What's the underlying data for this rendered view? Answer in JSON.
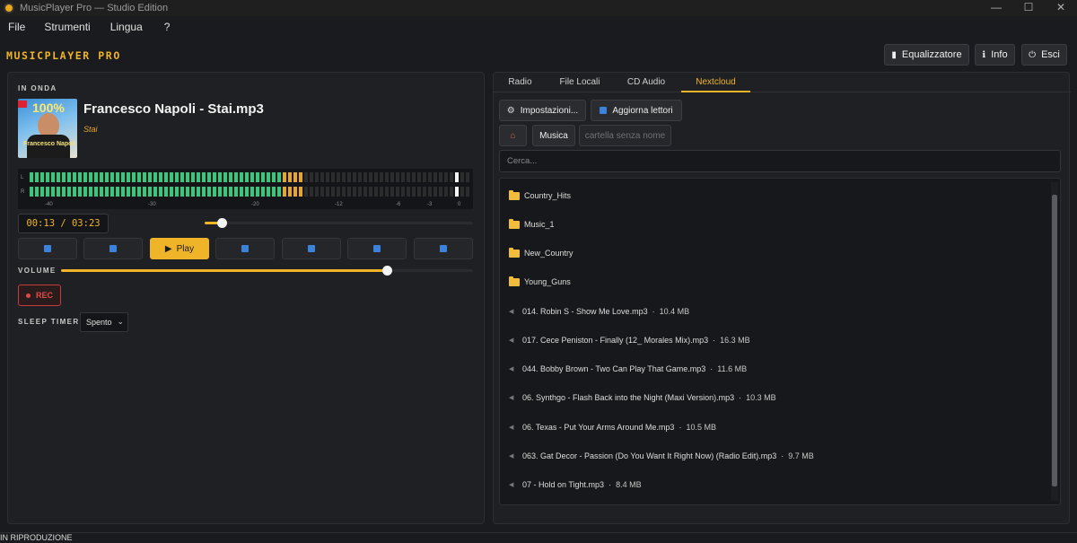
{
  "window": {
    "title": "MusicPlayer Pro — Studio Edition",
    "controls": [
      "—",
      "☐",
      "✕"
    ]
  },
  "menu": [
    "File",
    "Strumenti",
    "Lingua",
    "?"
  ],
  "brand": "MUSICPLAYER PRO",
  "toolbar": {
    "equalizer": "Equalizzatore",
    "info": "Info",
    "exit": "Esci"
  },
  "player": {
    "on_air_label": "IN ONDA",
    "title": "Francesco Napoli - Stai.mp3",
    "subtitle": "Stai",
    "cover_text": "100%",
    "cover_artist": "Francesco Napoli",
    "meter": {
      "channels": [
        "L",
        "R"
      ],
      "scale": [
        "-40",
        "-30",
        "-20",
        "-12",
        "-6",
        "-3",
        "0"
      ]
    },
    "time_display": "00:13 / 03:23",
    "seek_fraction": 0.065,
    "play_label": "Play",
    "controls": [
      "shuffle",
      "previous",
      "play",
      "pause",
      "stop",
      "next",
      "repeat"
    ],
    "volume_label": "VOLUME",
    "volume_fraction": 0.79,
    "rec_label": "REC",
    "sleep_label": "SLEEP TIMER",
    "sleep_value": "Spento"
  },
  "browser": {
    "tabs": [
      "Radio",
      "File Locali",
      "CD Audio",
      "Nextcloud"
    ],
    "active_tab": "Nextcloud",
    "settings_label": "Impostazioni...",
    "refresh_label": "Aggiorna lettori",
    "path": [
      "Musica",
      "cartella senza nome"
    ],
    "search_placeholder": "Cerca...",
    "folders": [
      "Country_Hits",
      "Music_1",
      "New_Country",
      "Young_Guns"
    ],
    "files": [
      {
        "name": "014. Robin S - Show Me Love.mp3",
        "size": "10.4 MB"
      },
      {
        "name": "017. Cece Peniston - Finally (12_ Morales Mix).mp3",
        "size": "16.3 MB"
      },
      {
        "name": "044. Bobby Brown - Two Can Play That Game.mp3",
        "size": "11.6 MB"
      },
      {
        "name": "06. Synthgo - Flash Back into the Night (Maxi Version).mp3",
        "size": "10.3 MB"
      },
      {
        "name": "06. Texas - Put Your Arms Around Me.mp3",
        "size": "10.5 MB"
      },
      {
        "name": "063. Gat Decor - Passion (Do You Want It Right Now) (Radio Edit).mp3",
        "size": "9.7 MB"
      },
      {
        "name": "07 - Hold on Tight.mp3",
        "size": "8.4 MB"
      }
    ]
  },
  "status": "IN RIPRODUZIONE",
  "colors": {
    "accent": "#f0b428",
    "meter_green": "#35c97f",
    "rec_red": "#e04848",
    "background": "#1a1b1e"
  }
}
